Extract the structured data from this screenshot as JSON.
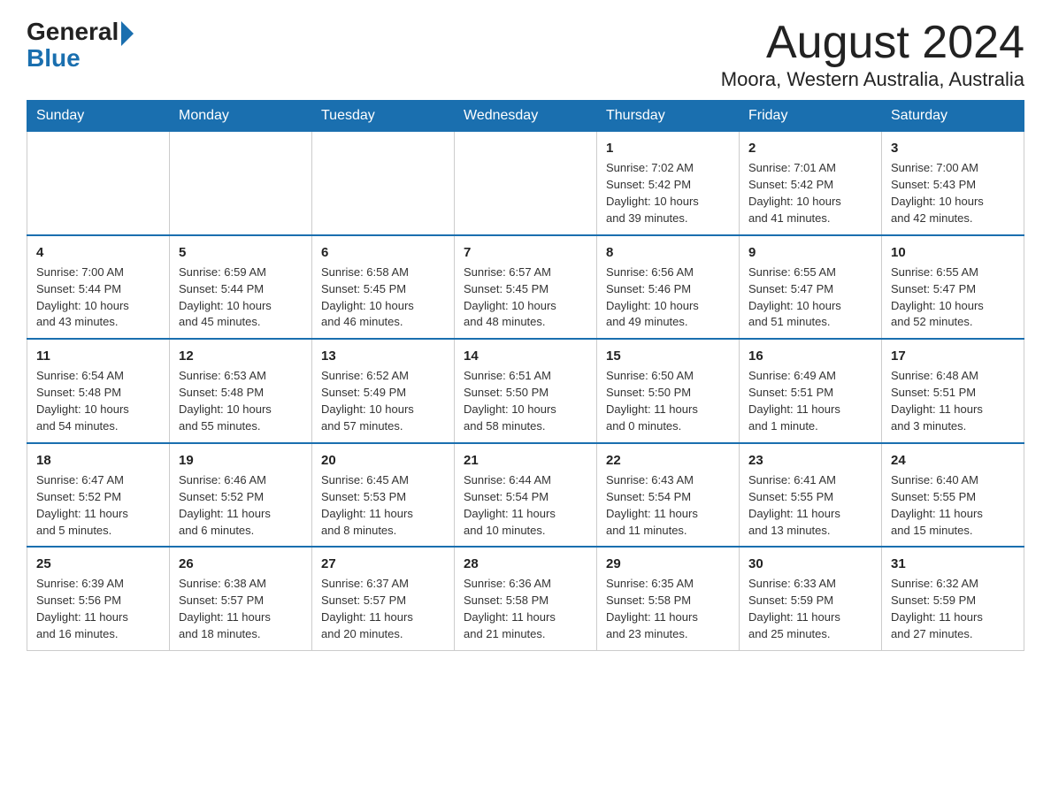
{
  "header": {
    "logo_general": "General",
    "logo_blue": "Blue",
    "month_title": "August 2024",
    "location": "Moora, Western Australia, Australia"
  },
  "weekdays": [
    "Sunday",
    "Monday",
    "Tuesday",
    "Wednesday",
    "Thursday",
    "Friday",
    "Saturday"
  ],
  "weeks": [
    [
      {
        "day": "",
        "info": ""
      },
      {
        "day": "",
        "info": ""
      },
      {
        "day": "",
        "info": ""
      },
      {
        "day": "",
        "info": ""
      },
      {
        "day": "1",
        "info": "Sunrise: 7:02 AM\nSunset: 5:42 PM\nDaylight: 10 hours\nand 39 minutes."
      },
      {
        "day": "2",
        "info": "Sunrise: 7:01 AM\nSunset: 5:42 PM\nDaylight: 10 hours\nand 41 minutes."
      },
      {
        "day": "3",
        "info": "Sunrise: 7:00 AM\nSunset: 5:43 PM\nDaylight: 10 hours\nand 42 minutes."
      }
    ],
    [
      {
        "day": "4",
        "info": "Sunrise: 7:00 AM\nSunset: 5:44 PM\nDaylight: 10 hours\nand 43 minutes."
      },
      {
        "day": "5",
        "info": "Sunrise: 6:59 AM\nSunset: 5:44 PM\nDaylight: 10 hours\nand 45 minutes."
      },
      {
        "day": "6",
        "info": "Sunrise: 6:58 AM\nSunset: 5:45 PM\nDaylight: 10 hours\nand 46 minutes."
      },
      {
        "day": "7",
        "info": "Sunrise: 6:57 AM\nSunset: 5:45 PM\nDaylight: 10 hours\nand 48 minutes."
      },
      {
        "day": "8",
        "info": "Sunrise: 6:56 AM\nSunset: 5:46 PM\nDaylight: 10 hours\nand 49 minutes."
      },
      {
        "day": "9",
        "info": "Sunrise: 6:55 AM\nSunset: 5:47 PM\nDaylight: 10 hours\nand 51 minutes."
      },
      {
        "day": "10",
        "info": "Sunrise: 6:55 AM\nSunset: 5:47 PM\nDaylight: 10 hours\nand 52 minutes."
      }
    ],
    [
      {
        "day": "11",
        "info": "Sunrise: 6:54 AM\nSunset: 5:48 PM\nDaylight: 10 hours\nand 54 minutes."
      },
      {
        "day": "12",
        "info": "Sunrise: 6:53 AM\nSunset: 5:48 PM\nDaylight: 10 hours\nand 55 minutes."
      },
      {
        "day": "13",
        "info": "Sunrise: 6:52 AM\nSunset: 5:49 PM\nDaylight: 10 hours\nand 57 minutes."
      },
      {
        "day": "14",
        "info": "Sunrise: 6:51 AM\nSunset: 5:50 PM\nDaylight: 10 hours\nand 58 minutes."
      },
      {
        "day": "15",
        "info": "Sunrise: 6:50 AM\nSunset: 5:50 PM\nDaylight: 11 hours\nand 0 minutes."
      },
      {
        "day": "16",
        "info": "Sunrise: 6:49 AM\nSunset: 5:51 PM\nDaylight: 11 hours\nand 1 minute."
      },
      {
        "day": "17",
        "info": "Sunrise: 6:48 AM\nSunset: 5:51 PM\nDaylight: 11 hours\nand 3 minutes."
      }
    ],
    [
      {
        "day": "18",
        "info": "Sunrise: 6:47 AM\nSunset: 5:52 PM\nDaylight: 11 hours\nand 5 minutes."
      },
      {
        "day": "19",
        "info": "Sunrise: 6:46 AM\nSunset: 5:52 PM\nDaylight: 11 hours\nand 6 minutes."
      },
      {
        "day": "20",
        "info": "Sunrise: 6:45 AM\nSunset: 5:53 PM\nDaylight: 11 hours\nand 8 minutes."
      },
      {
        "day": "21",
        "info": "Sunrise: 6:44 AM\nSunset: 5:54 PM\nDaylight: 11 hours\nand 10 minutes."
      },
      {
        "day": "22",
        "info": "Sunrise: 6:43 AM\nSunset: 5:54 PM\nDaylight: 11 hours\nand 11 minutes."
      },
      {
        "day": "23",
        "info": "Sunrise: 6:41 AM\nSunset: 5:55 PM\nDaylight: 11 hours\nand 13 minutes."
      },
      {
        "day": "24",
        "info": "Sunrise: 6:40 AM\nSunset: 5:55 PM\nDaylight: 11 hours\nand 15 minutes."
      }
    ],
    [
      {
        "day": "25",
        "info": "Sunrise: 6:39 AM\nSunset: 5:56 PM\nDaylight: 11 hours\nand 16 minutes."
      },
      {
        "day": "26",
        "info": "Sunrise: 6:38 AM\nSunset: 5:57 PM\nDaylight: 11 hours\nand 18 minutes."
      },
      {
        "day": "27",
        "info": "Sunrise: 6:37 AM\nSunset: 5:57 PM\nDaylight: 11 hours\nand 20 minutes."
      },
      {
        "day": "28",
        "info": "Sunrise: 6:36 AM\nSunset: 5:58 PM\nDaylight: 11 hours\nand 21 minutes."
      },
      {
        "day": "29",
        "info": "Sunrise: 6:35 AM\nSunset: 5:58 PM\nDaylight: 11 hours\nand 23 minutes."
      },
      {
        "day": "30",
        "info": "Sunrise: 6:33 AM\nSunset: 5:59 PM\nDaylight: 11 hours\nand 25 minutes."
      },
      {
        "day": "31",
        "info": "Sunrise: 6:32 AM\nSunset: 5:59 PM\nDaylight: 11 hours\nand 27 minutes."
      }
    ]
  ]
}
